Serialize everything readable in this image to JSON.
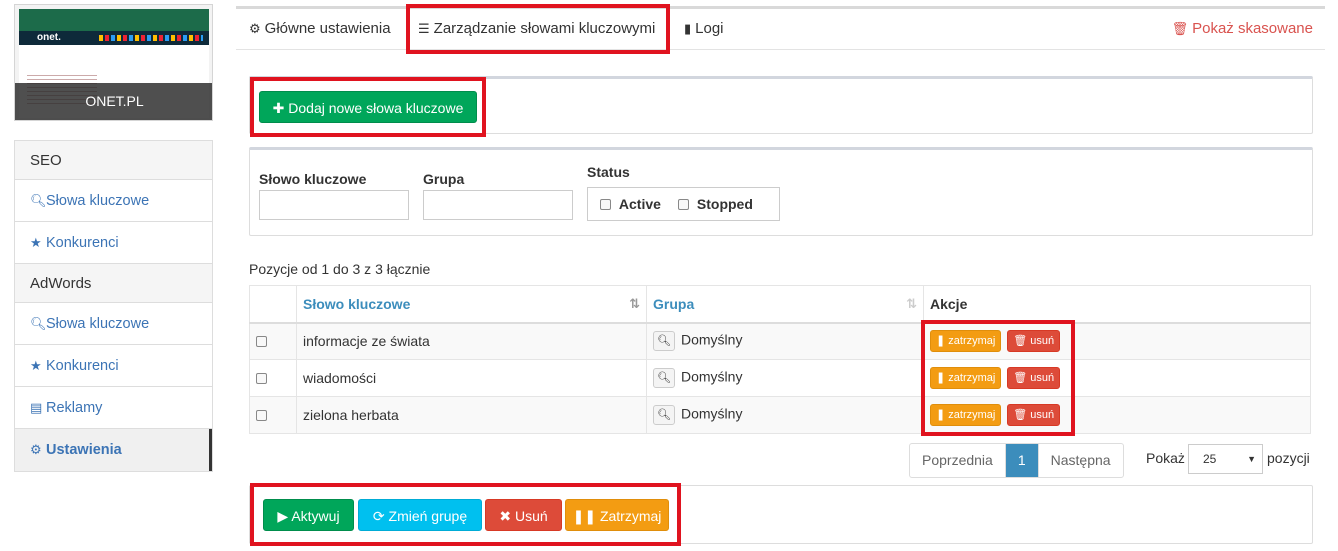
{
  "site": {
    "name": "ONET.PL",
    "thumb_logo": "onet."
  },
  "sidebar": {
    "sections": [
      {
        "title": "SEO",
        "items": [
          {
            "label": "Słowa kluczowe",
            "icon": "search-icon"
          },
          {
            "label": "Konkurenci",
            "icon": "trophy-icon"
          }
        ]
      },
      {
        "title": "AdWords",
        "items": [
          {
            "label": "Słowa kluczowe",
            "icon": "search-icon"
          },
          {
            "label": "Konkurenci",
            "icon": "trophy-icon"
          },
          {
            "label": "Reklamy",
            "icon": "ad-icon"
          },
          {
            "label": "Ustawienia",
            "icon": "gear-icon",
            "active": true
          }
        ]
      }
    ]
  },
  "tabs": {
    "general": "Główne ustawienia",
    "keywords": "Zarządzanie słowami kluczowymi",
    "logs": "Logi",
    "deleted": "Pokaż skasowane"
  },
  "add_button": "Dodaj nowe słowa kluczowe",
  "filters": {
    "keyword_label": "Słowo kluczowe",
    "group_label": "Grupa",
    "status_label": "Status",
    "status_active": "Active",
    "status_stopped": "Stopped"
  },
  "table": {
    "info": "Pozycje od 1 do 3 z 3 łącznie",
    "headers": {
      "keyword": "Słowo kluczowe",
      "group": "Grupa",
      "actions": "Akcje"
    },
    "rows": [
      {
        "keyword": "informacje ze świata",
        "group": "Domyślny"
      },
      {
        "keyword": "wiadomości",
        "group": "Domyślny"
      },
      {
        "keyword": "zielona herbata",
        "group": "Domyślny"
      }
    ],
    "action_stop": "zatrzymaj",
    "action_delete": "usuń"
  },
  "pagination": {
    "prev": "Poprzednia",
    "current": "1",
    "next": "Następna",
    "show_label": "Pokaż",
    "page_size": "25",
    "suffix": "pozycji"
  },
  "bulk": {
    "activate": "Aktywuj",
    "change_group": "Zmień grupę",
    "delete": "Usuń",
    "stop": "Zatrzymaj"
  },
  "colors": {
    "highlight": "#e0131f",
    "link": "#3c8dbc",
    "green": "#00a65a",
    "teal": "#00c0ef",
    "red": "#dd4b39",
    "orange": "#f39c12"
  }
}
